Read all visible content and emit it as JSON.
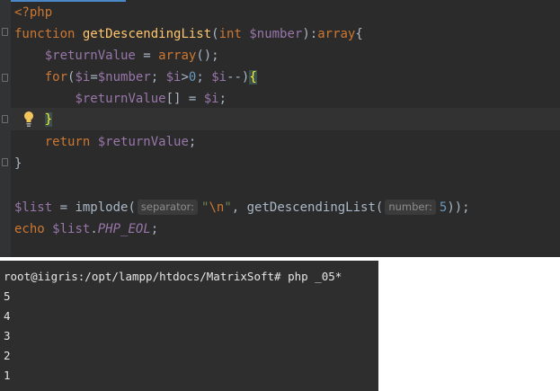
{
  "editor": {
    "line1": {
      "open_tag": "<?php"
    },
    "line2": {
      "kw_function": "function",
      "fn_name": "getDescendingList",
      "paren_open": "(",
      "type_int": "int",
      "param": "$number",
      "paren_close": "):",
      "return_type": "array",
      "brace": "{"
    },
    "line3": {
      "var": "$returnValue",
      "assign": " = ",
      "kw_array": "array",
      "tail": "();"
    },
    "line4": {
      "kw_for": "for",
      "p1": "(",
      "v1": "$i",
      "eq": "=",
      "v2": "$number",
      "semi1": "; ",
      "v3": "$i",
      "gt": ">",
      "zero": "0",
      "semi2": "; ",
      "v4": "$i",
      "dec": "--)",
      "brace": "{"
    },
    "line5": {
      "var": "$returnValue",
      "mid": "[] = ",
      "v2": "$i",
      "semi": ";"
    },
    "line6": {
      "brace": "}"
    },
    "line7": {
      "kw_return": "return",
      "var": "$returnValue",
      "semi": ";"
    },
    "line8": {
      "brace": "}"
    },
    "line10": {
      "var": "$list",
      "assign": " = implode(",
      "hint1": "separator:",
      "str_open": "\"",
      "esc": "\\n",
      "str_close": "\"",
      "comma": ", getDescendingList(",
      "hint2": "number:",
      "num": "5",
      "close": "));"
    },
    "line11": {
      "kw_echo": "echo",
      "var": "$list",
      "dot": ".",
      "const": "PHP_EOL",
      "semi": ";"
    }
  },
  "terminal": {
    "prompt": "root@iigris:/opt/lampp/htdocs/MatrixSoft# php _05*",
    "output": [
      "5",
      "4",
      "3",
      "2",
      "1"
    ]
  },
  "colors": {
    "editor_bg": "#2b2b2b",
    "keyword": "#cc7832",
    "function": "#ffc66d",
    "variable": "#9876aa",
    "number": "#6897bb",
    "string": "#6a8759",
    "terminal_bg": "#2e2e2e"
  }
}
